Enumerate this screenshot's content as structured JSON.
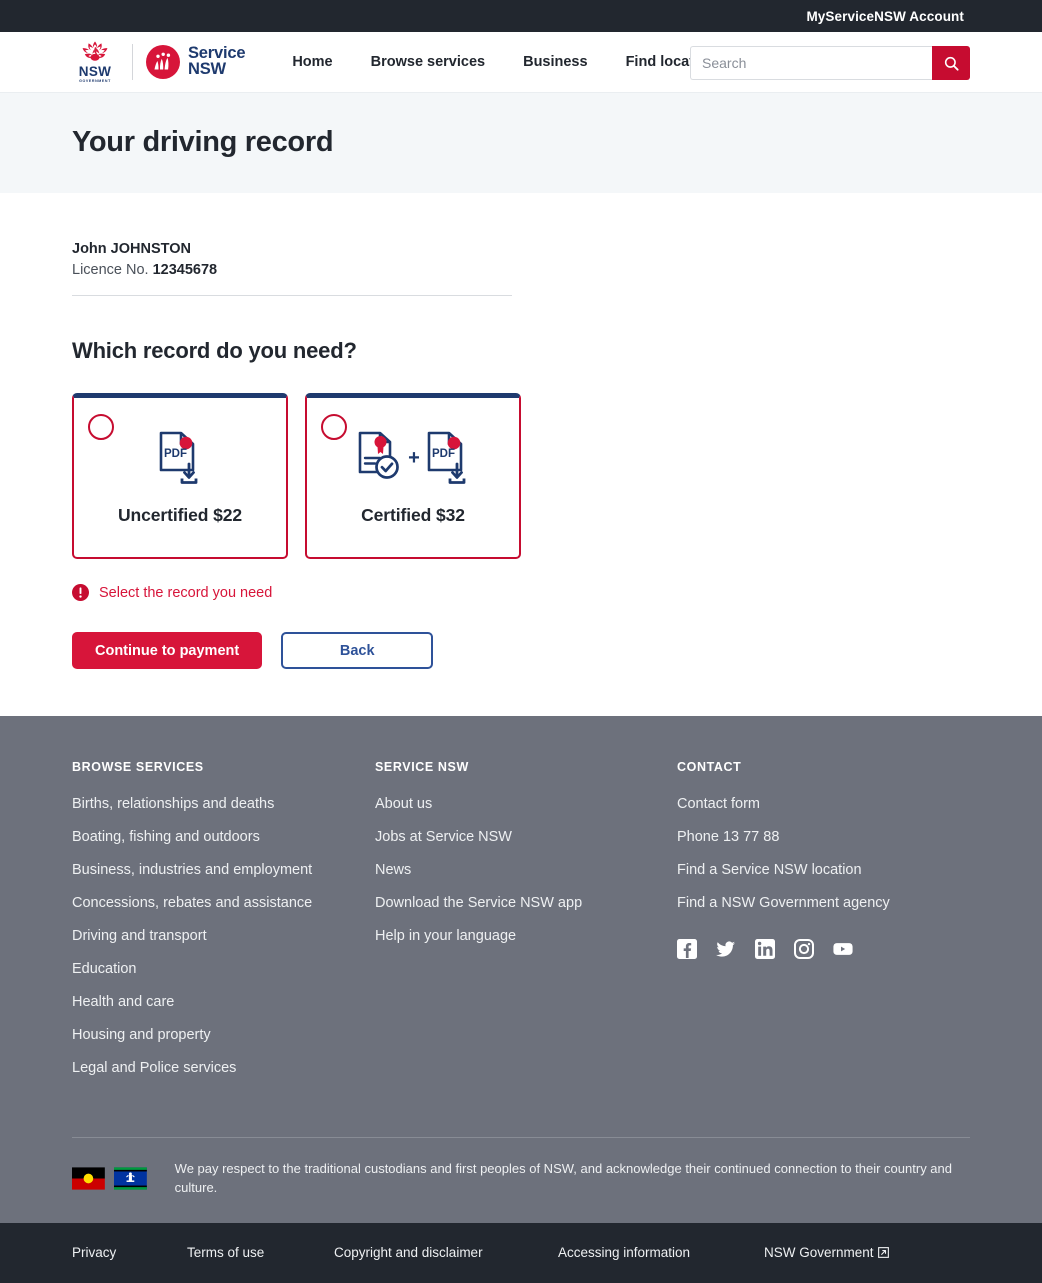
{
  "utility_bar": {
    "account_link": "MyServiceNSW Account"
  },
  "header": {
    "logo": {
      "nsw_word": "NSW",
      "government_word": "GOVERNMENT",
      "service_line1": "Service",
      "service_line2": "NSW",
      "waratah_icon": "nsw-waratah-icon",
      "service_circle_icon": "service-nsw-circle-icon"
    },
    "nav": [
      {
        "label": "Home"
      },
      {
        "label": "Browse services"
      },
      {
        "label": "Business"
      },
      {
        "label": "Find locations"
      }
    ],
    "search": {
      "placeholder": "Search",
      "value": "",
      "button_icon": "search-icon"
    }
  },
  "page": {
    "title": "Your driving record"
  },
  "customer": {
    "name": "John JOHNSTON",
    "licence_label": "Licence No.",
    "licence_number": "12345678"
  },
  "record_selection": {
    "heading": "Which record do you need?",
    "options": [
      {
        "label": "Uncertified $22",
        "icon": "pdf-download-icon",
        "selected": false
      },
      {
        "label": "Certified $32",
        "icon": "certificate-check-plus-pdf-icon",
        "plus": "+",
        "selected": false
      }
    ],
    "error": {
      "icon": "error-exclamation-icon",
      "message": "Select the record you need"
    }
  },
  "actions": {
    "primary_label": "Continue to payment",
    "secondary_label": "Back"
  },
  "footer": {
    "columns": [
      {
        "heading": "BROWSE SERVICES",
        "links": [
          "Births, relationships and deaths",
          "Boating, fishing and outdoors",
          "Business, industries and employment",
          "Concessions, rebates and assistance",
          "Driving and transport",
          "Education",
          "Health and care",
          "Housing and property",
          "Legal and Police services"
        ]
      },
      {
        "heading": "SERVICE NSW",
        "links": [
          "About us",
          "Jobs at Service NSW",
          "News",
          "Download the Service NSW app",
          "Help in your language"
        ]
      },
      {
        "heading": "CONTACT",
        "links": [
          "Contact form",
          "Phone 13 77 88",
          "Find a Service NSW location",
          "Find a NSW Government agency"
        ]
      }
    ],
    "social": [
      {
        "name": "facebook-icon"
      },
      {
        "name": "twitter-icon"
      },
      {
        "name": "linkedin-icon"
      },
      {
        "name": "instagram-icon"
      },
      {
        "name": "youtube-icon"
      }
    ],
    "acknowledgement": {
      "aboriginal_flag": "aboriginal-flag-icon",
      "torres_strait_flag": "torres-strait-islander-flag-icon",
      "text": "We pay respect to the traditional custodians and first peoples of NSW, and acknowledge their continued connection to their country and culture."
    }
  },
  "bottom_bar": {
    "links": [
      {
        "label": "Privacy",
        "external": false
      },
      {
        "label": "Terms of use",
        "external": false
      },
      {
        "label": "Copyright and disclaimer",
        "external": false
      },
      {
        "label": "Accessing information",
        "external": false
      },
      {
        "label": "NSW Government",
        "external": true
      }
    ]
  },
  "colors": {
    "brand_red": "#c60c30",
    "error_red": "#d7153a",
    "navy": "#1e3a6e",
    "link_blue": "#2e5299",
    "footer_grey": "#6d717c",
    "dark_bar": "#22272f",
    "title_band": "#f4f7f9"
  }
}
